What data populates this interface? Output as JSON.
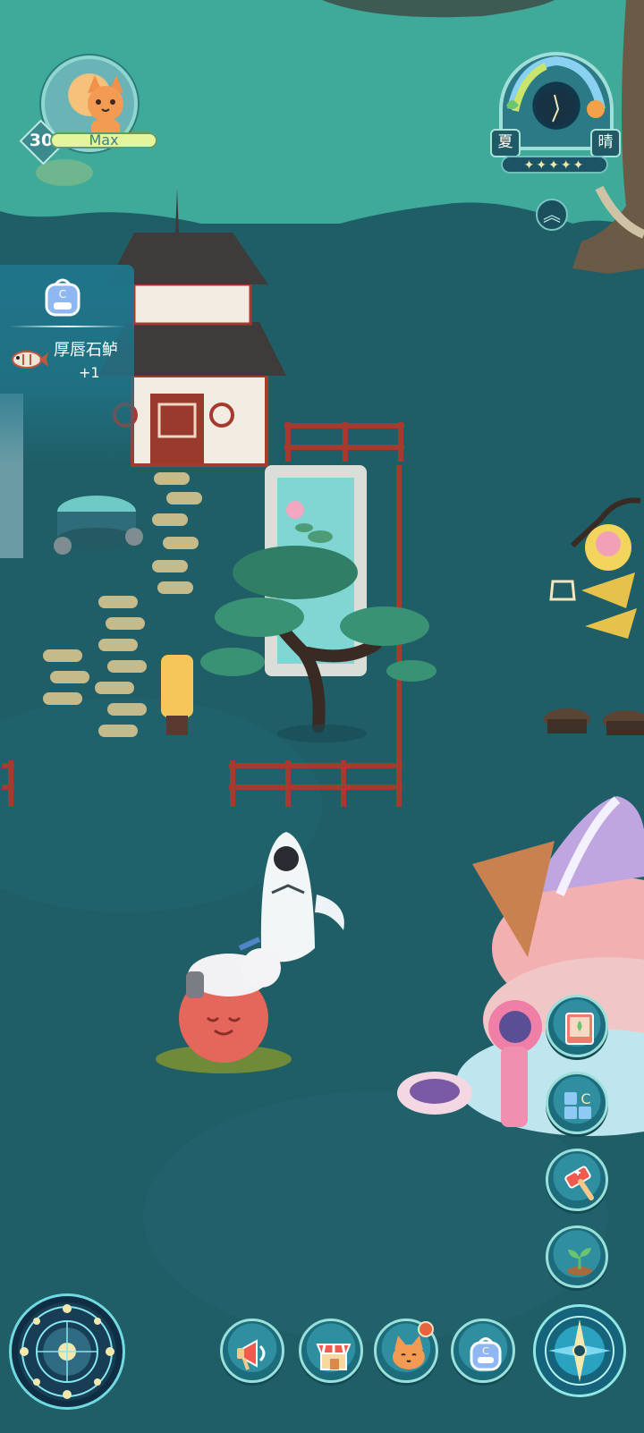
{
  "player": {
    "level": "30",
    "xp_label": "Max"
  },
  "weather": {
    "season": "夏",
    "condition": "晴",
    "stars": "✦✦✦✦✦",
    "expand_icon": "double-chevron-up-icon"
  },
  "notification": {
    "icon": "backpack-icon",
    "item_icon": "fish-icon",
    "item_name": "厚唇石鲈",
    "item_count": "+1"
  },
  "toolbar": {
    "buttons": [
      {
        "icon": "megaphone-icon"
      },
      {
        "icon": "shop-icon"
      },
      {
        "icon": "fox-pet-icon",
        "badge": true
      },
      {
        "icon": "backpack-icon"
      }
    ]
  },
  "side_buttons": [
    {
      "icon": "guide-book-icon"
    },
    {
      "icon": "layout-icon"
    },
    {
      "icon": "hammer-icon"
    },
    {
      "icon": "sprout-icon"
    }
  ],
  "colors": {
    "water": "#1f5e66",
    "grass": "#3fa99a",
    "accent": "#9adfd9",
    "badge": "#e8643e"
  }
}
